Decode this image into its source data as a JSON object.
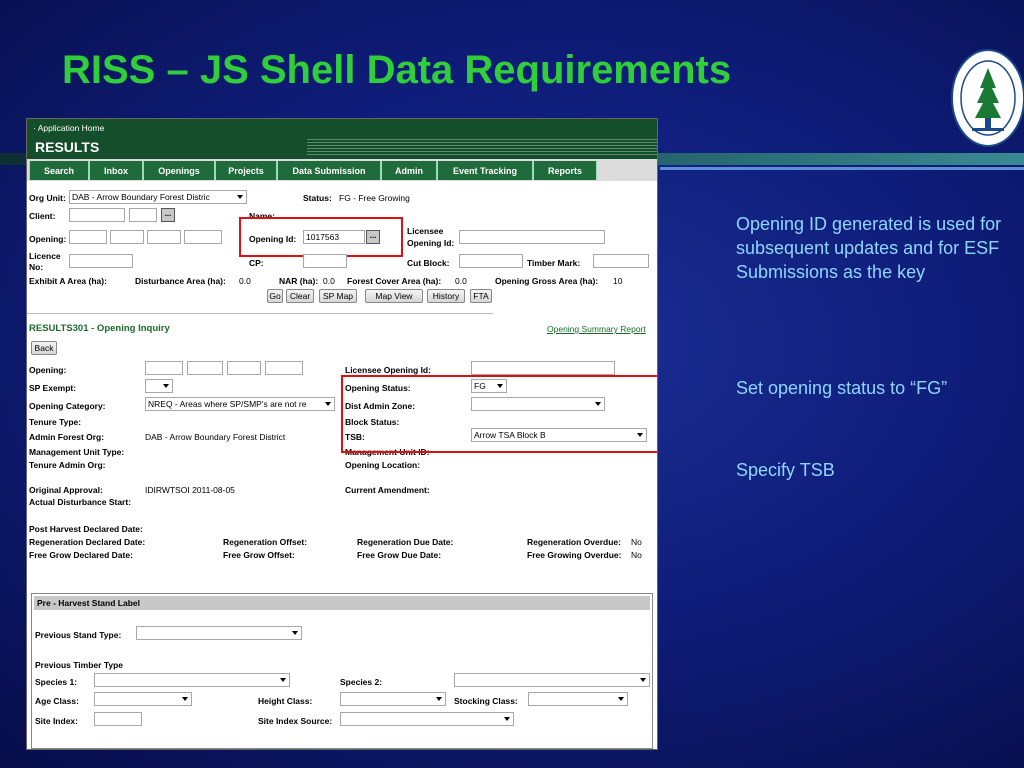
{
  "slide": {
    "title": "RISS – JS Shell Data Requirements",
    "notes": [
      "Opening ID generated is used for subsequent updates and for ESF Submissions as the key",
      "Set opening status to “FG”",
      "Specify TSB"
    ]
  },
  "colors": {
    "title": "#2fce3a",
    "note": "#8fd6ff",
    "app_header": "#154e2a",
    "tab": "#1f6b3b",
    "highlight": "#e01010"
  },
  "app": {
    "home_link": "· Application Home",
    "name": "RESULTS",
    "tabs": [
      "Search",
      "Inbox",
      "Openings",
      "Projects",
      "Data Submission",
      "Admin",
      "Event Tracking",
      "Reports"
    ]
  },
  "search": {
    "org_unit_label": "Org Unit:",
    "org_unit_value": "DAB - Arrow Boundary Forest Distric",
    "status_label": "Status:",
    "status_value": "FG - Free Growing",
    "client_label": "Client:",
    "name_label": "Name:",
    "opening_label": "Opening:",
    "opening_id_label": "Opening Id:",
    "opening_id_value": "1017563",
    "licensee_label": "Licensee",
    "licensee_label2": "Opening Id:",
    "licence_label": "Licence",
    "licence_label2": "No:",
    "cp_label": "CP:",
    "cut_block_label": "Cut Block:",
    "timber_mark_label": "Timber Mark:",
    "exhibit_label": "Exhibit A Area (ha):",
    "disturbance_label": "Disturbance Area (ha):",
    "disturbance_value": "0.0",
    "nar_label": "NAR (ha):",
    "nar_value": "0.0",
    "forest_cover_label": "Forest Cover Area (ha):",
    "forest_cover_value": "0.0",
    "gross_label": "Opening Gross Area (ha):",
    "gross_value": "10",
    "buttons": [
      "Go",
      "Clear",
      "SP Map",
      "Map View",
      "History",
      "FTA"
    ]
  },
  "inquiry": {
    "title": "RESULTS301",
    "title_suffix": " - Opening Inquiry",
    "summary_link": "Opening Summary Report",
    "back": "Back",
    "opening": "Opening:",
    "licensee_opening_id": "Licensee Opening Id:",
    "sp_exempt": "SP Exempt:",
    "opening_status": "Opening Status:",
    "opening_status_value": "FG",
    "opening_category": "Opening Category:",
    "opening_category_value": "NREQ - Areas where SP/SMP's are not re",
    "dist_admin_zone": "Dist Admin Zone:",
    "tenure_type": "Tenure Type:",
    "block_status": "Block Status:",
    "admin_forest_org": "Admin Forest Org:",
    "admin_forest_org_value": "DAB - Arrow Boundary Forest District",
    "tsb": "TSB:",
    "tsb_value": "Arrow TSA Block B",
    "mgmt_unit_type": "Management Unit Type:",
    "mgmt_unit_id": "Management Unit ID:",
    "tenure_admin_org": "Tenure Admin Org:",
    "opening_location": "Opening Location:",
    "original_approval": "Original Approval:",
    "original_approval_value": "IDIRWTSOI 2011-08-05",
    "current_amendment": "Current Amendment:",
    "actual_disturbance": "Actual Disturbance Start:",
    "post_harvest": "Post Harvest Declared Date:",
    "regen_declared": "Regeneration Declared Date:",
    "regen_offset": "Regeneration Offset:",
    "regen_due": "Regeneration Due Date:",
    "regen_overdue": "Regeneration Overdue:",
    "regen_overdue_value": "No",
    "free_grow_declared": "Free Grow Declared Date:",
    "free_grow_offset": "Free Grow Offset:",
    "free_grow_due": "Free Grow Due Date:",
    "free_growing_overdue": "Free Growing Overdue:",
    "free_growing_overdue_value": "No"
  },
  "stand": {
    "header": "Pre - Harvest Stand Label",
    "previous_stand_type": "Previous Stand Type:",
    "previous_timber_type": "Previous Timber Type",
    "species1": "Species 1:",
    "species2": "Species 2:",
    "age_class": "Age Class:",
    "height_class": "Height Class:",
    "stocking_class": "Stocking Class:",
    "site_index": "Site Index:",
    "site_index_source": "Site Index Source:"
  }
}
